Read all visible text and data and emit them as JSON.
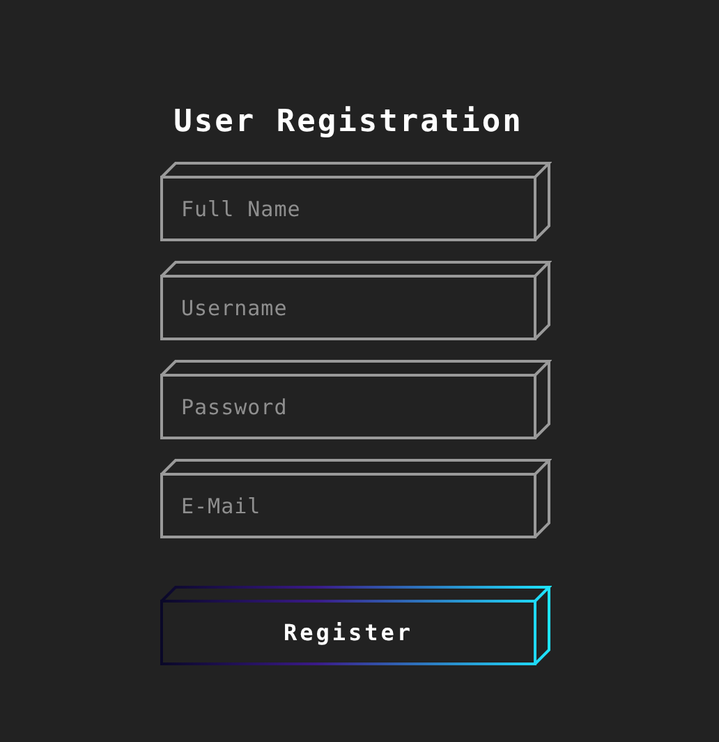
{
  "title": "User Registration",
  "fields": [
    {
      "placeholder": "Full Name"
    },
    {
      "placeholder": "Username"
    },
    {
      "placeholder": "Password"
    },
    {
      "placeholder": "E-Mail"
    }
  ],
  "button": {
    "label": "Register"
  }
}
